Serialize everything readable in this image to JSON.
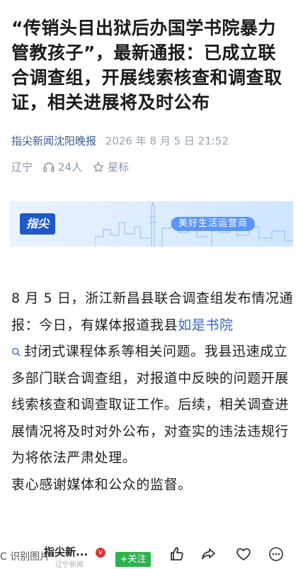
{
  "article": {
    "title": "“传销头目出狱后办国学书院暴力管教孩子”，最新通报：已成立联合调查组，开展线索核查和调查取证，相关进展将及时公布",
    "source": "指尖新闻沈阳晚报",
    "datetime": "2026 年 8 月 5 日  21:52",
    "region": "辽宁",
    "listeners": "24人",
    "star_label": "星标"
  },
  "banner": {
    "logo_text": "指尖",
    "slogan": "美好生活运营商"
  },
  "body": {
    "p1_before_link": "8 月 5 日，浙江新昌县联合调查组发布情况通报：今日，有媒体报道我县",
    "p1_link": "如是书院",
    "p1_after_link": "封闭式课程体系等相关问题。我县迅速成立多部门联合调查组，对报道中反映的问题开展线索核查和调查取证工作。后续，相关调查进展情况将及时对外公布，对查实的违法违规行为将依法严肃处理。",
    "p2": "衷心感谢媒体和公众的监督。"
  },
  "bottom_bar": {
    "ocr_label": "C 识别图片",
    "channel_name": "指尖新...",
    "channel_sub": "辽宁新闻",
    "badge": "v",
    "follow_label": "+关注"
  },
  "icons": {
    "headphones": "headphones-icon",
    "star": "star-outline-icon",
    "search": "search-icon",
    "like": "thumbs-up-icon",
    "share": "share-icon",
    "favorite": "heart-icon",
    "more": "more-icon"
  }
}
